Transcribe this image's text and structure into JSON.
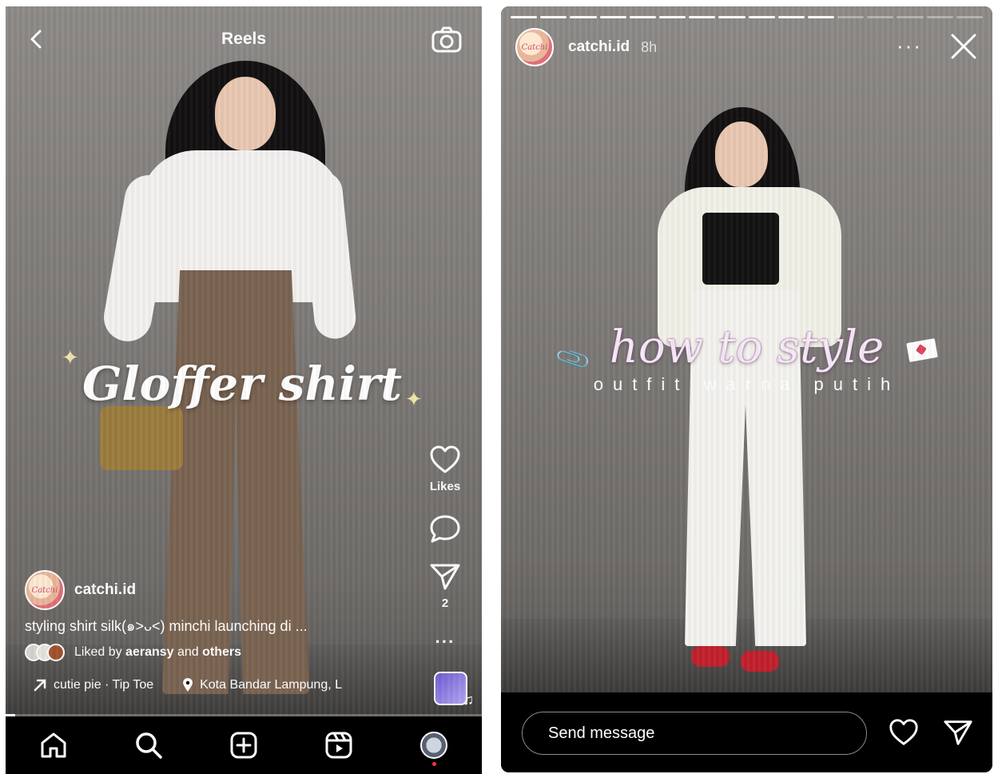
{
  "reels": {
    "header": {
      "title": "Reels",
      "back_icon": "chevron-left-icon",
      "camera_icon": "camera-icon"
    },
    "overlay_text": "Gloffer shirt",
    "actions": {
      "like": {
        "icon": "heart-icon",
        "label": "Likes"
      },
      "comment": {
        "icon": "comment-icon"
      },
      "share": {
        "icon": "send-icon",
        "count": "2"
      },
      "more": {
        "icon": "more-icon",
        "label": "···"
      }
    },
    "author": {
      "username": "catchi.id",
      "avatar_text": "Catchi"
    },
    "caption": "styling shirt silk(๑˃ᴗ˂) minchi launching di ...",
    "liked_by": {
      "prefix": "Liked by ",
      "user": "aeransy",
      "middle": " and ",
      "suffix": "others"
    },
    "audio": {
      "label": "cutie pie · Tip Toe",
      "icon": "arrow-up-right-icon"
    },
    "location": {
      "label": "Kota Bandar Lampung, L",
      "icon": "location-pin-icon"
    },
    "progress": 0.02,
    "nav": [
      {
        "name": "home",
        "icon": "home-icon"
      },
      {
        "name": "search",
        "icon": "search-icon"
      },
      {
        "name": "create",
        "icon": "plus-square-icon"
      },
      {
        "name": "reels",
        "icon": "reels-icon"
      },
      {
        "name": "profile",
        "icon": "profile-avatar"
      }
    ],
    "colors": {
      "background": "#000000",
      "notification_dot": "#ff3040"
    }
  },
  "story": {
    "username": "catchi.id",
    "time": "8h",
    "avatar_text": "Catchi",
    "more_label": "···",
    "bars_total": 16,
    "bars_seen": 11,
    "title": "how to style",
    "subtitle": "outfit warna putih",
    "message_placeholder": "Send message",
    "icons": {
      "close": "close-icon",
      "heart": "heart-icon",
      "send": "send-icon",
      "clip": "paperclip-icon",
      "letter": "love-letter-icon"
    }
  }
}
